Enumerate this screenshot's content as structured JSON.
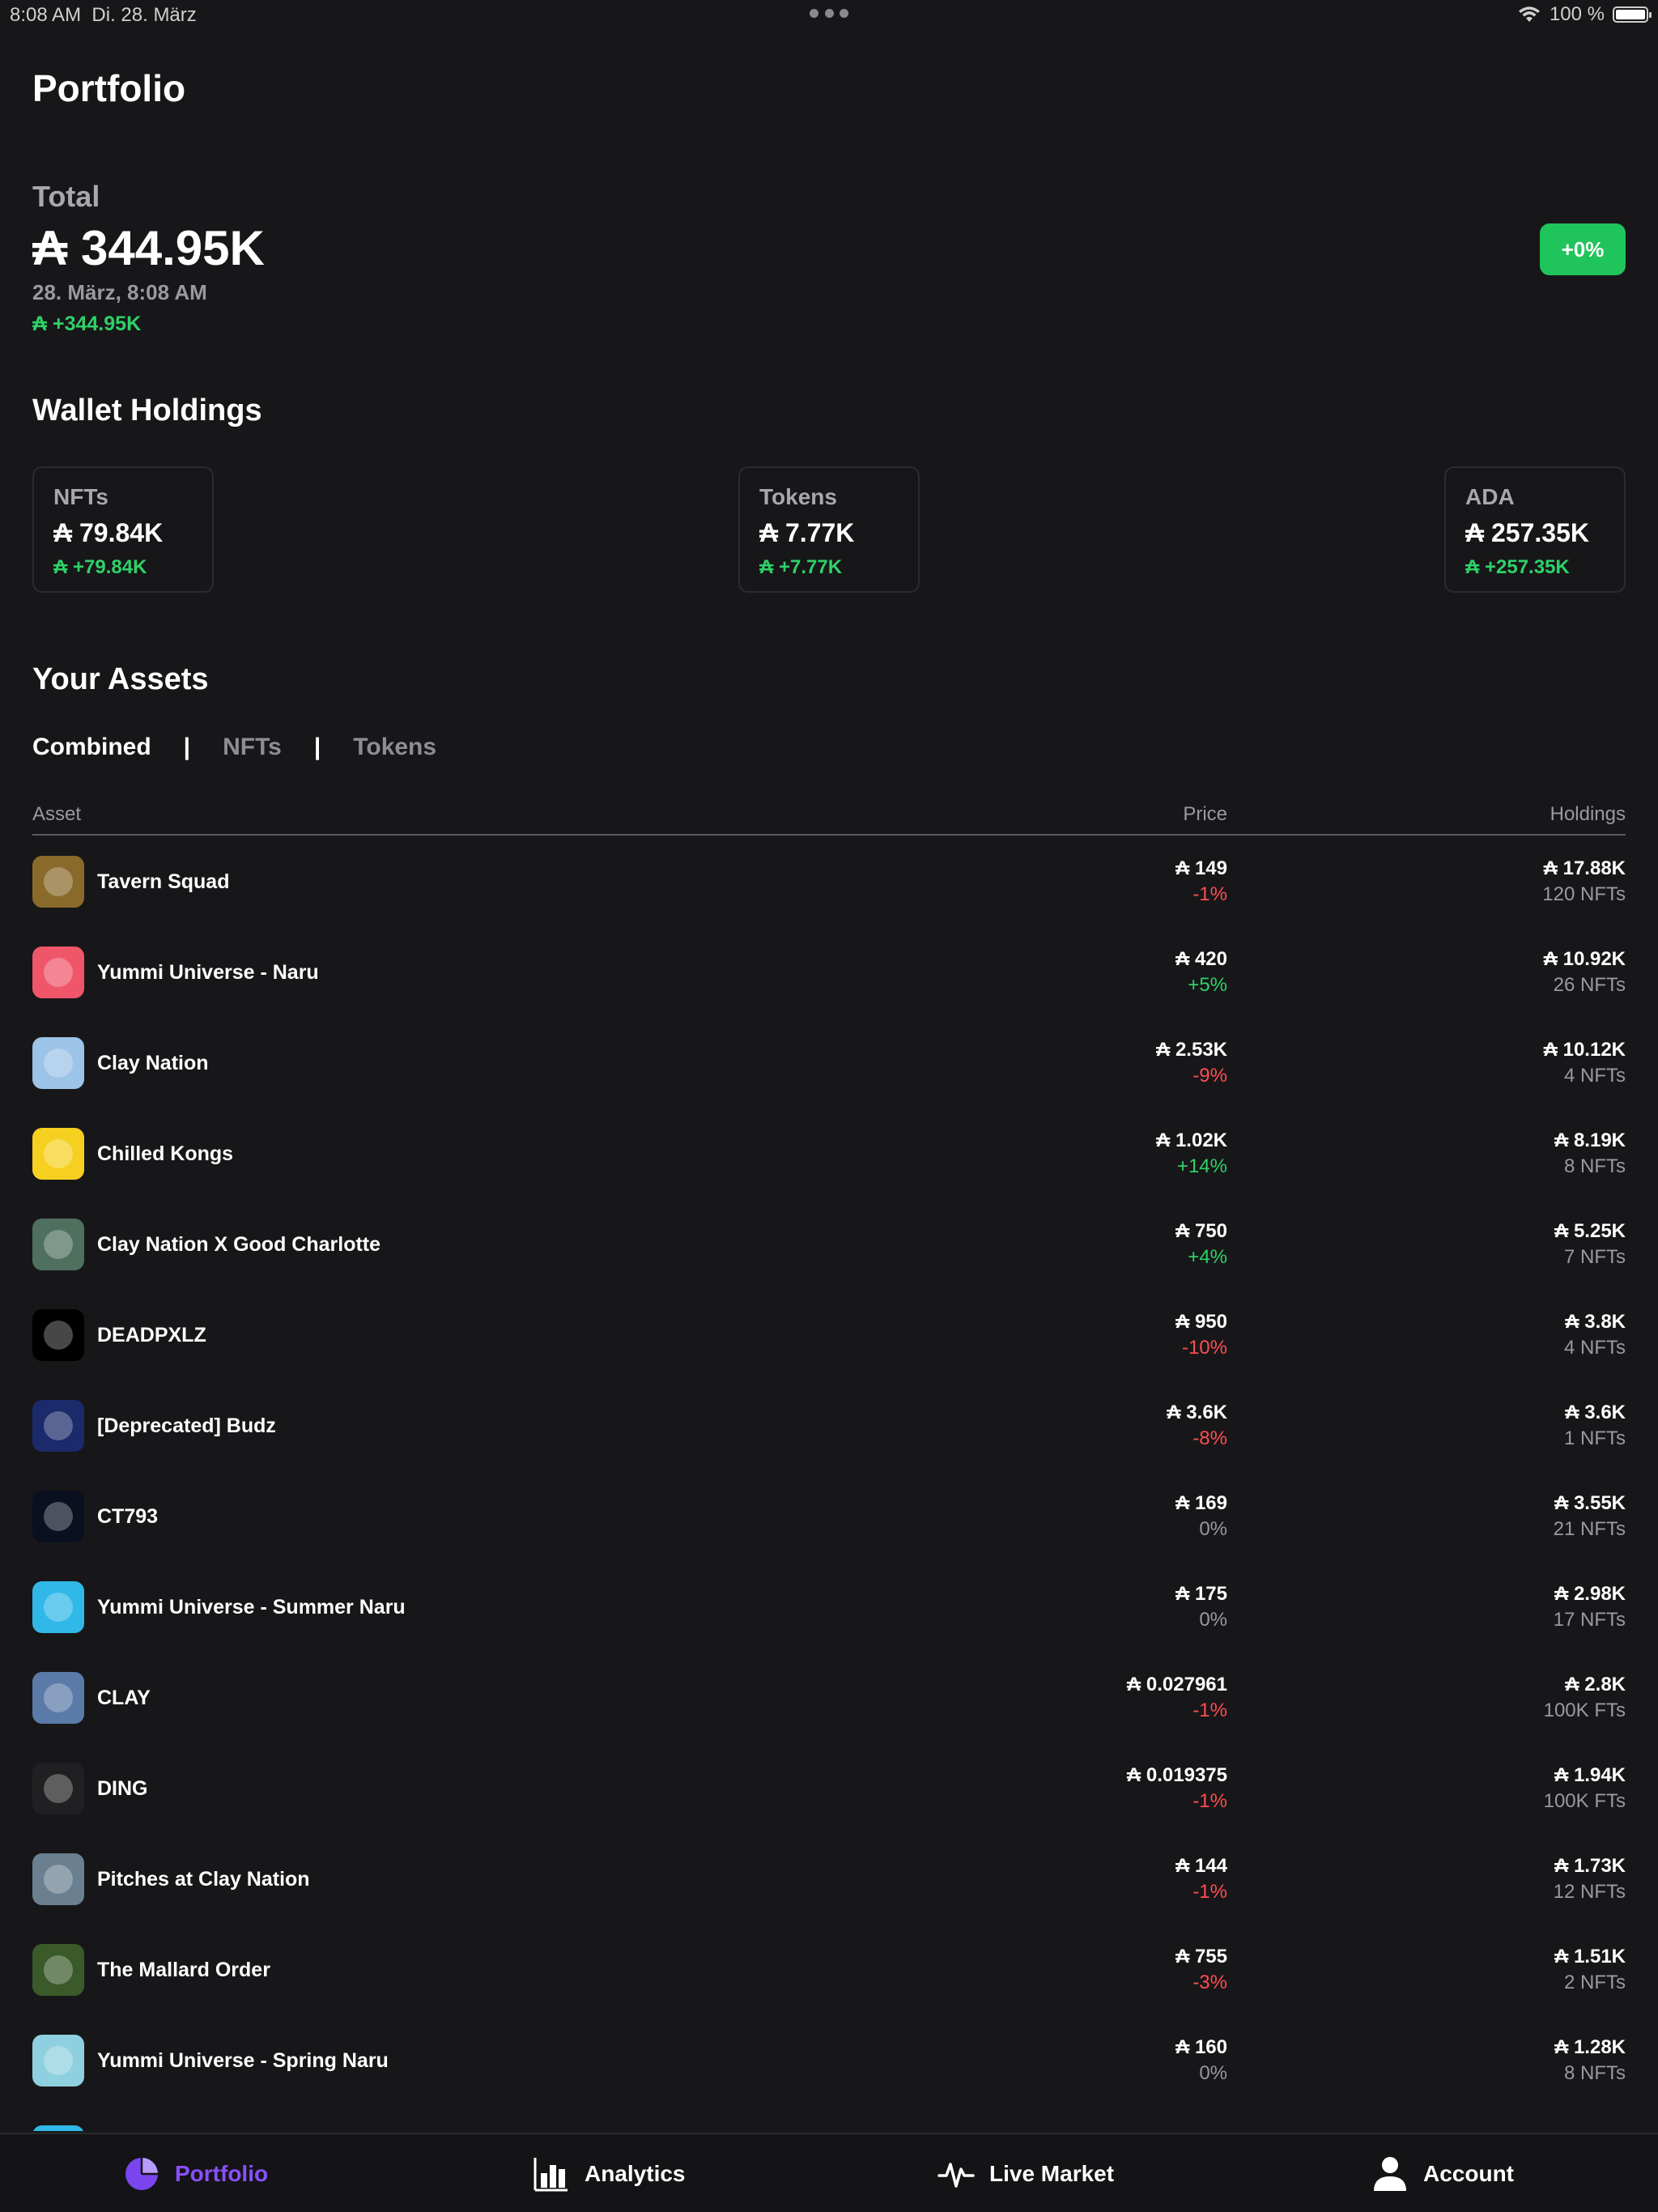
{
  "status_bar": {
    "time": "8:08 AM",
    "date": "Di. 28. März",
    "battery": "100 %"
  },
  "page_title": "Portfolio",
  "total": {
    "label": "Total",
    "value": "₳ 344.95K",
    "date": "28. März, 8:08 AM",
    "change": "₳ +344.95K",
    "percent_badge": "+0%"
  },
  "wallet": {
    "title": "Wallet Holdings",
    "cards": [
      {
        "label": "NFTs",
        "value": "₳ 79.84K",
        "change": "₳ +79.84K"
      },
      {
        "label": "Tokens",
        "value": "₳ 7.77K",
        "change": "₳ +7.77K"
      },
      {
        "label": "ADA",
        "value": "₳ 257.35K",
        "change": "₳ +257.35K"
      }
    ]
  },
  "assets": {
    "title": "Your Assets",
    "tabs": [
      "Combined",
      "NFTs",
      "Tokens"
    ],
    "separator": "|",
    "columns": {
      "asset": "Asset",
      "price": "Price",
      "holdings": "Holdings"
    },
    "rows": [
      {
        "name": "Tavern Squad",
        "price": "₳ 149",
        "change": "-1%",
        "trend": "neg",
        "holding_value": "₳ 17.88K",
        "holding_qty": "120 NFTs",
        "color": "#8a6a2a"
      },
      {
        "name": "Yummi Universe - Naru",
        "price": "₳ 420",
        "change": "+5%",
        "trend": "pos",
        "holding_value": "₳ 10.92K",
        "holding_qty": "26 NFTs",
        "color": "#f0566a"
      },
      {
        "name": "Clay Nation",
        "price": "₳ 2.53K",
        "change": "-9%",
        "trend": "neg",
        "holding_value": "₳ 10.12K",
        "holding_qty": "4 NFTs",
        "color": "#9cc3e8"
      },
      {
        "name": "Chilled Kongs",
        "price": "₳ 1.02K",
        "change": "+14%",
        "trend": "pos",
        "holding_value": "₳ 8.19K",
        "holding_qty": "8 NFTs",
        "color": "#f5d020"
      },
      {
        "name": "Clay Nation X Good Charlotte",
        "price": "₳ 750",
        "change": "+4%",
        "trend": "pos",
        "holding_value": "₳ 5.25K",
        "holding_qty": "7 NFTs",
        "color": "#4f6f5f"
      },
      {
        "name": "DEADPXLZ",
        "price": "₳ 950",
        "change": "-10%",
        "trend": "neg",
        "holding_value": "₳ 3.8K",
        "holding_qty": "4 NFTs",
        "color": "#000000"
      },
      {
        "name": "[Deprecated] Budz",
        "price": "₳ 3.6K",
        "change": "-8%",
        "trend": "neg",
        "holding_value": "₳ 3.6K",
        "holding_qty": "1 NFTs",
        "color": "#1a2a6a"
      },
      {
        "name": "CT793",
        "price": "₳ 169",
        "change": "0%",
        "trend": "neu",
        "holding_value": "₳ 3.55K",
        "holding_qty": "21 NFTs",
        "color": "#0a1020"
      },
      {
        "name": "Yummi Universe - Summer Naru",
        "price": "₳ 175",
        "change": "0%",
        "trend": "neu",
        "holding_value": "₳ 2.98K",
        "holding_qty": "17 NFTs",
        "color": "#30b8e8"
      },
      {
        "name": "CLAY",
        "price": "₳ 0.027961",
        "change": "-1%",
        "trend": "neg",
        "holding_value": "₳ 2.8K",
        "holding_qty": "100K FTs",
        "color": "#5a7aa8"
      },
      {
        "name": "DING",
        "price": "₳ 0.019375",
        "change": "-1%",
        "trend": "neg",
        "holding_value": "₳ 1.94K",
        "holding_qty": "100K FTs",
        "color": "#202022"
      },
      {
        "name": "Pitches at Clay Nation",
        "price": "₳ 144",
        "change": "-1%",
        "trend": "neg",
        "holding_value": "₳ 1.73K",
        "holding_qty": "12 NFTs",
        "color": "#6a8090"
      },
      {
        "name": "The Mallard Order",
        "price": "₳ 755",
        "change": "-3%",
        "trend": "neg",
        "holding_value": "₳ 1.51K",
        "holding_qty": "2 NFTs",
        "color": "#3a5a2a"
      },
      {
        "name": "Yummi Universe - Spring Naru",
        "price": "₳ 160",
        "change": "0%",
        "trend": "neu",
        "holding_value": "₳ 1.28K",
        "holding_qty": "8 NFTs",
        "color": "#8fd0e0"
      },
      {
        "name": "",
        "price": "",
        "change": "",
        "trend": "neu",
        "holding_value": "",
        "holding_qty": "",
        "color": "#30b8e8"
      }
    ]
  },
  "tabbar": {
    "items": [
      {
        "label": "Portfolio",
        "icon": "pie-chart-icon",
        "active": true
      },
      {
        "label": "Analytics",
        "icon": "bar-chart-icon",
        "active": false
      },
      {
        "label": "Live Market",
        "icon": "pulse-icon",
        "active": false
      },
      {
        "label": "Account",
        "icon": "person-icon",
        "active": false
      }
    ]
  }
}
